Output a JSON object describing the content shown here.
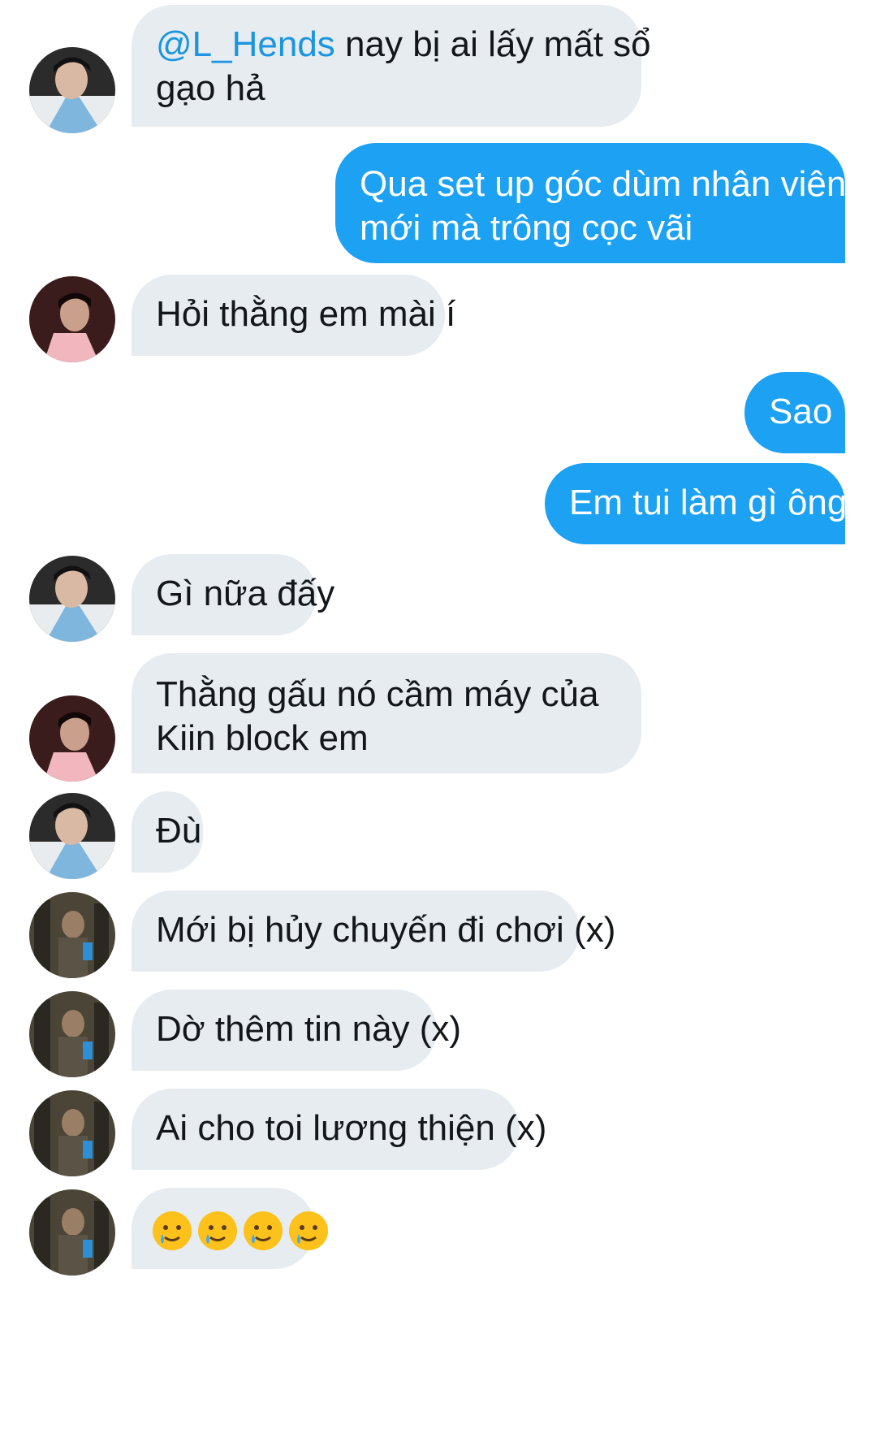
{
  "messages": [
    {
      "side": "in",
      "avatar": "avatar-blue-hanbok",
      "mention": "@L_Hends",
      "text_after_mention": " nay bị ai lấy mất sổ",
      "line2": "gạo hả"
    },
    {
      "side": "out",
      "line1": "Qua set up góc dùm nhân viên",
      "line2": "mới mà trông cọc vãi"
    },
    {
      "side": "in",
      "avatar": "avatar-dark-profile",
      "text": "Hỏi thằng em mài í"
    },
    {
      "side": "out",
      "text": "Sao"
    },
    {
      "side": "out",
      "text": "Em tui làm gì ông"
    },
    {
      "side": "in",
      "avatar": "avatar-blue-hanbok",
      "text": "Gì nữa đấy"
    },
    {
      "side": "in",
      "avatar": "avatar-dark-profile",
      "line1": "Thằng gấu nó cầm máy của",
      "line2": "Kiin block em"
    },
    {
      "side": "in",
      "avatar": "avatar-blue-hanbok",
      "text": "Đù"
    },
    {
      "side": "in",
      "avatar": "avatar-gym-mirror",
      "text": "Mới bị hủy chuyến đi chơi (x)"
    },
    {
      "side": "in",
      "avatar": "avatar-gym-mirror",
      "text": "Dờ thêm tin này (x)"
    },
    {
      "side": "in",
      "avatar": "avatar-gym-mirror",
      "text": "Ai cho toi lương thiện (x)"
    },
    {
      "side": "in",
      "avatar": "avatar-gym-mirror",
      "emoji": "smiling-face-with-tear",
      "emoji_count": 4
    }
  ],
  "colors": {
    "incoming_bubble": "#e6ecf0",
    "outgoing_bubble": "#1da1f2",
    "mention": "#1b95e0",
    "text": "#14171a"
  }
}
